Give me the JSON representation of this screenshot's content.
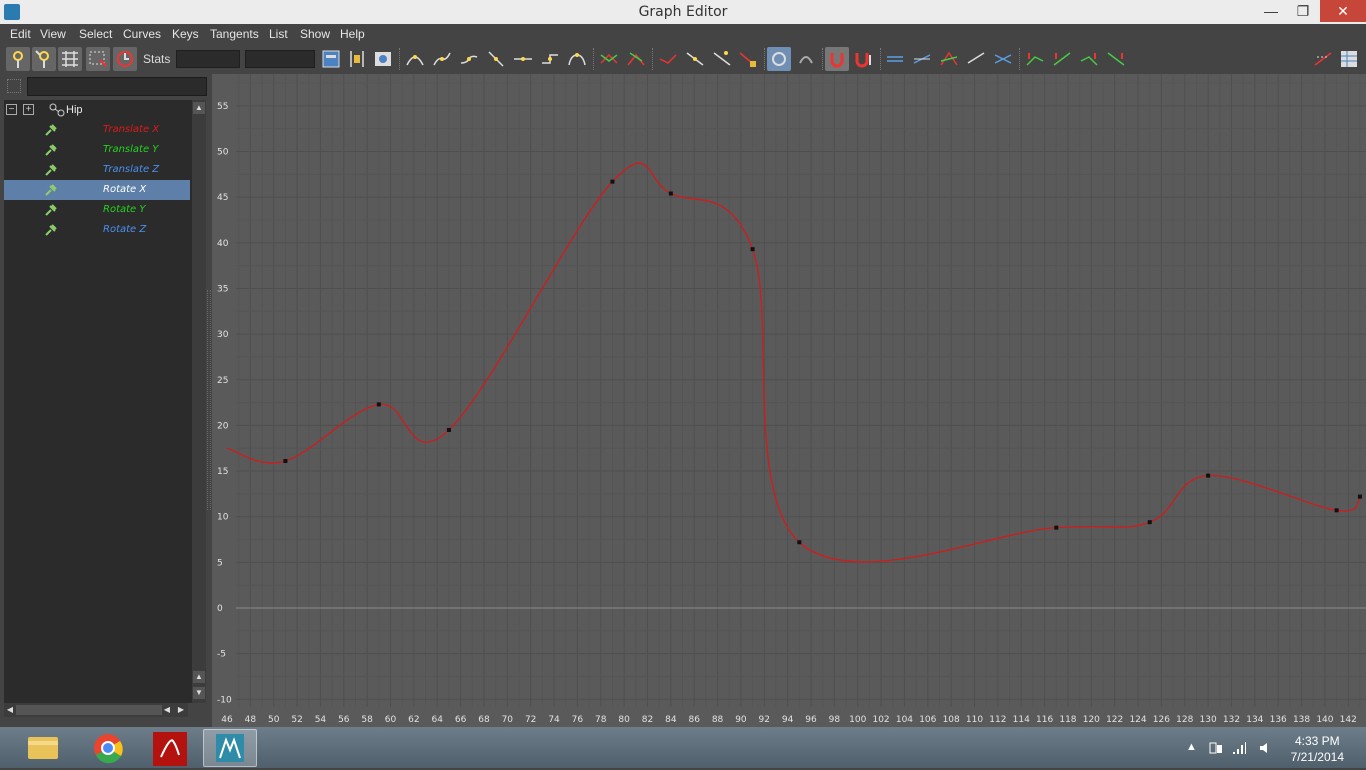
{
  "window": {
    "title": "Graph Editor",
    "minimize": "—",
    "maximize": "❐",
    "close": "✕"
  },
  "menu": [
    "Edit",
    "View",
    "Select",
    "Curves",
    "Keys",
    "Tangents",
    "List",
    "Show",
    "Help"
  ],
  "toolbar": {
    "stats_label": "Stats",
    "stats_value_1": "",
    "stats_value_2": ""
  },
  "outliner": {
    "root": "Hip",
    "channels": [
      {
        "label": "Translate X",
        "color": "#e01818"
      },
      {
        "label": "Translate Y",
        "color": "#24d21e"
      },
      {
        "label": "Translate Z",
        "color": "#4c8ef0"
      },
      {
        "label": "Rotate X",
        "color": "#ffffff",
        "selected": true
      },
      {
        "label": "Rotate Y",
        "color": "#24d21e"
      },
      {
        "label": "Rotate Z",
        "color": "#4c8ef0"
      }
    ]
  },
  "graph": {
    "curve_color": "#d41a1a",
    "x_ticks": [
      46,
      48,
      50,
      52,
      54,
      56,
      58,
      60,
      62,
      64,
      66,
      68,
      70,
      72,
      74,
      76,
      78,
      80,
      82,
      84,
      86,
      88,
      90,
      92,
      94,
      96,
      98,
      100,
      102,
      104,
      106,
      108,
      110,
      112,
      114,
      116,
      118,
      120,
      122,
      124,
      126,
      128,
      130,
      132,
      134,
      136,
      138,
      140,
      142
    ],
    "y_ticks": [
      55,
      50,
      45,
      40,
      35,
      30,
      25,
      20,
      15,
      10,
      5,
      0,
      -5,
      -10
    ],
    "keys": [
      {
        "x": 51,
        "y": 16.1
      },
      {
        "x": 59,
        "y": 22.3
      },
      {
        "x": 65,
        "y": 19.5
      },
      {
        "x": 79,
        "y": 46.7
      },
      {
        "x": 84,
        "y": 45.4
      },
      {
        "x": 91,
        "y": 39.3
      },
      {
        "x": 95,
        "y": 7.2
      },
      {
        "x": 117,
        "y": 8.8
      },
      {
        "x": 125,
        "y": 9.4
      },
      {
        "x": 130,
        "y": 14.5
      },
      {
        "x": 141,
        "y": 10.7
      },
      {
        "x": 143,
        "y": 12.2
      }
    ]
  },
  "taskbar": {
    "apps": [
      "file-explorer",
      "chrome",
      "acrobat",
      "maya-lt"
    ],
    "time": "4:33 PM",
    "date": "7/21/2014"
  }
}
